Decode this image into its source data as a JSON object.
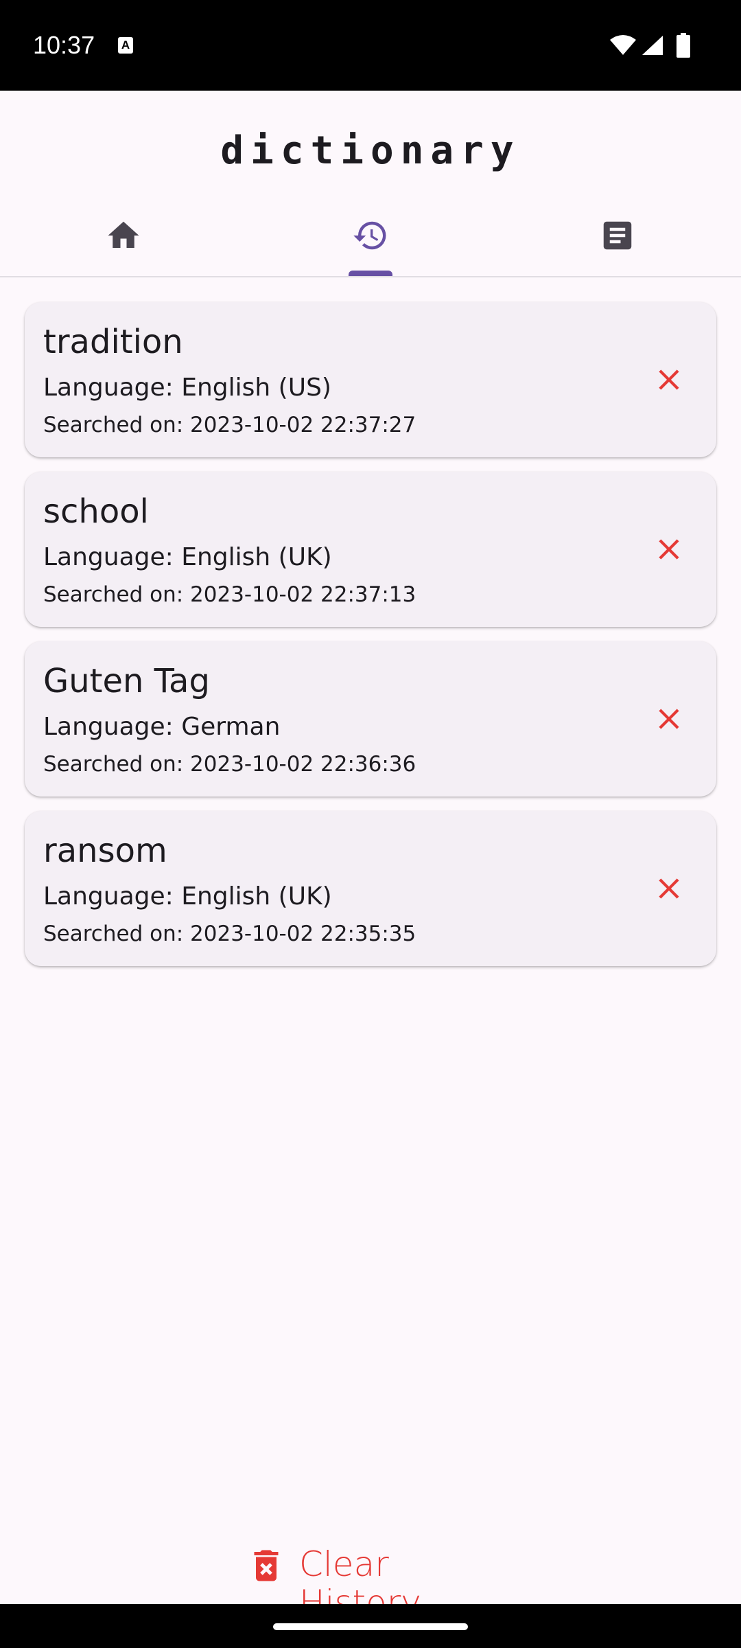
{
  "status_bar": {
    "time": "10:37",
    "notification_icon": "a-badge-icon",
    "icons": [
      "wifi-icon",
      "cellular-signal-icon",
      "battery-icon"
    ]
  },
  "header": {
    "title": "dictionary"
  },
  "tabs": [
    {
      "id": "home",
      "icon": "home-icon",
      "selected": false
    },
    {
      "id": "history",
      "icon": "history-icon",
      "selected": true
    },
    {
      "id": "saved",
      "icon": "article-icon",
      "selected": false
    }
  ],
  "history": {
    "items": [
      {
        "word": "tradition",
        "language": "Language: English (US)",
        "searched": "Searched on: 2023-10-02 22:37:27",
        "delete_icon": "close-icon"
      },
      {
        "word": "school",
        "language": "Language: English (UK)",
        "searched": "Searched on: 2023-10-02 22:37:13",
        "delete_icon": "close-icon"
      },
      {
        "word": "Guten Tag",
        "language": "Language: German",
        "searched": "Searched on: 2023-10-02 22:36:36",
        "delete_icon": "close-icon"
      },
      {
        "word": "ransom",
        "language": "Language: English (UK)",
        "searched": "Searched on: 2023-10-02 22:35:35",
        "delete_icon": "close-icon"
      }
    ]
  },
  "clear_button": {
    "label": "Clear History",
    "icon": "trash-icon"
  },
  "colors": {
    "accent": "#6750a4",
    "danger": "#e53935",
    "card_background": "#f4eff5",
    "page_background": "#fdf8fc",
    "tab_icon_inactive": "#49454f"
  }
}
